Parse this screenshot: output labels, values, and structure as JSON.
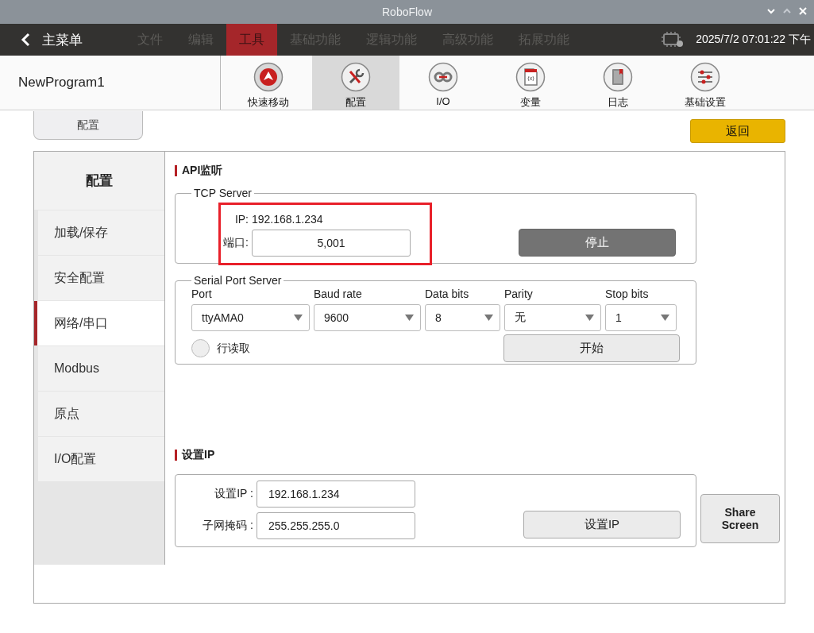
{
  "window": {
    "title": "RoboFlow"
  },
  "menu_bar": {
    "back_label": "主菜单",
    "items": [
      {
        "label": "文件",
        "selected": false
      },
      {
        "label": "编辑",
        "selected": false
      },
      {
        "label": "工具",
        "selected": true
      },
      {
        "label": "基础功能",
        "selected": false
      },
      {
        "label": "逻辑功能",
        "selected": false
      },
      {
        "label": "高级功能",
        "selected": false
      },
      {
        "label": "拓展功能",
        "selected": false
      }
    ],
    "datetime": "2025/7/2 07:01:22 下午"
  },
  "toolbar": {
    "program_name": "NewProgram1",
    "tools": [
      {
        "kind": "move",
        "label": "快速移动",
        "selected": false
      },
      {
        "kind": "config",
        "label": "配置",
        "selected": true
      },
      {
        "kind": "io",
        "label": "I/O",
        "selected": false
      },
      {
        "kind": "variable",
        "label": "变量",
        "selected": false
      },
      {
        "kind": "log",
        "label": "日志",
        "selected": false
      },
      {
        "kind": "settings",
        "label": "基础设置",
        "selected": false
      }
    ]
  },
  "page_tab": "配置",
  "back_button": "返回",
  "sidebar": {
    "title": "配置",
    "items": [
      {
        "label": "加载/保存",
        "selected": false
      },
      {
        "label": "安全配置",
        "selected": false
      },
      {
        "label": "网络/串口",
        "selected": true
      },
      {
        "label": "Modbus",
        "selected": false
      },
      {
        "label": "原点",
        "selected": false
      },
      {
        "label": "I/O配置",
        "selected": false
      }
    ]
  },
  "api_section": {
    "heading": "API监听",
    "tcp_server": {
      "legend": "TCP Server",
      "ip_label": "IP:",
      "ip_value": "192.168.1.234",
      "port_label": "端口:",
      "port_value": "5,001",
      "stop_button": "停止"
    },
    "serial_server": {
      "legend": "Serial Port Server",
      "fields": [
        {
          "label": "Port",
          "value": "ttyAMA0"
        },
        {
          "label": "Baud rate",
          "value": "9600"
        },
        {
          "label": "Data bits",
          "value": "8"
        },
        {
          "label": "Parity",
          "value": "无"
        },
        {
          "label": "Stop bits",
          "value": "1"
        }
      ],
      "line_read": {
        "label": "行读取",
        "checked": false
      },
      "start_button": "开始"
    }
  },
  "set_ip_section": {
    "heading": "设置IP",
    "fields": [
      {
        "label": "设置IP :",
        "value": "192.168.1.234"
      },
      {
        "label": "子网掩码 :",
        "value": "255.255.255.0"
      }
    ],
    "button": "设置IP"
  },
  "share_screen_button": "Share Screen"
}
